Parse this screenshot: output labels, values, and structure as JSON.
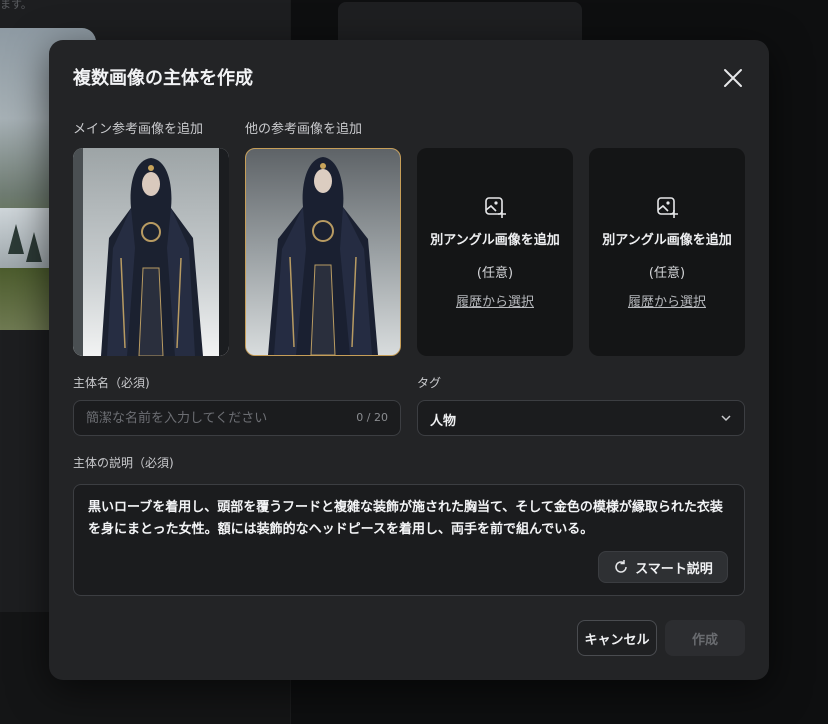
{
  "background": {
    "top_text": "ます。"
  },
  "modal": {
    "title": "複数画像の主体を作成",
    "main_ref_label": "メイン参考画像を追加",
    "other_ref_label": "他の参考画像を追加",
    "empty_cards": [
      {
        "title": "別アングル画像を追加",
        "optional": "(任意)",
        "link": "履歴から選択"
      },
      {
        "title": "別アングル画像を追加",
        "optional": "(任意)",
        "link": "履歴から選択"
      }
    ],
    "name_field": {
      "label": "主体名（必須)",
      "placeholder": "簡潔な名前を入力してください",
      "value": "",
      "counter": "0 / 20"
    },
    "tag_field": {
      "label": "タグ",
      "value": "人物"
    },
    "description": {
      "label": "主体の説明（必須)",
      "text": "黒いローブを着用し、頭部を覆うフードと複雑な装飾が施された胸当て、そして金色の模様が縁取られた衣装を身にまとった女性。額には装飾的なヘッドピースを着用し、両手を前で組んでいる。",
      "smart_button": "スマート説明"
    },
    "buttons": {
      "cancel": "キャンセル",
      "create": "作成"
    }
  },
  "colors": {
    "modal_bg": "#232426",
    "selected_border": "#c69e58",
    "field_border": "#3c3e42"
  },
  "icons": {
    "close": "close-icon",
    "add_image": "add-image-icon",
    "chevron": "chevron-down-icon",
    "smart": "refresh-icon"
  }
}
